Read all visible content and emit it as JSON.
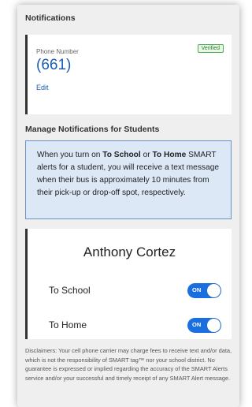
{
  "notifications": {
    "title": "Notifications",
    "phone_label": "Phone Number",
    "verified_badge": "Verified",
    "phone_number": "(661)",
    "edit_label": "Edit"
  },
  "manage": {
    "title": "Manage Notifications for Students",
    "info": {
      "part1": "When you turn on ",
      "bold1": "To School",
      "part2": " or ",
      "bold2": "To Home",
      "part3": " SMART alerts for a student, you will receive a text message when their bus is approximately 10 minutes from their pick-up or drop-off spot, respectively."
    }
  },
  "student": {
    "name": "Anthony Cortez",
    "to_school_label": "To School",
    "to_school_state": "ON",
    "to_home_label": "To Home",
    "to_home_state": "ON"
  },
  "disclaimer": "Disclaimers: Your cell phone carrier may charge fees to receive text and/or data, which is not the responsibility of SMART tag™ nor your school district. No guarantee is expressed or implied regarding the accuracy of the SMART Alerts service and/or your successful and timely receipt of any SMART Alert message.",
  "colors": {
    "accent": "#1a6fe0",
    "link": "#1a5bb8",
    "verified": "#2e7d32",
    "info_bg": "#dde8f7"
  }
}
